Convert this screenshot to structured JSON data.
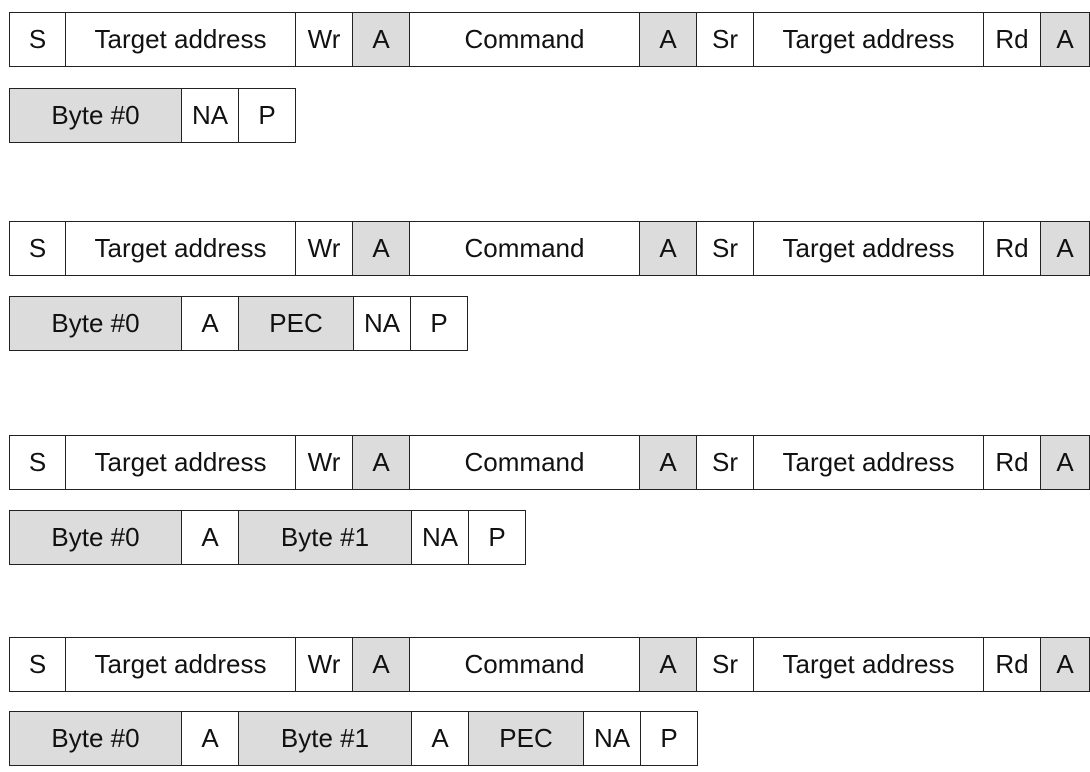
{
  "sequences": [
    {
      "line1": [
        "S",
        "Target address",
        "Wr",
        "A",
        "Command",
        "A",
        "Sr",
        "Target address",
        "Rd",
        "A"
      ],
      "line2": [
        "Byte #0",
        "NA",
        "P"
      ]
    },
    {
      "line1": [
        "S",
        "Target address",
        "Wr",
        "A",
        "Command",
        "A",
        "Sr",
        "Target address",
        "Rd",
        "A"
      ],
      "line2": [
        "Byte #0",
        "A",
        "PEC",
        "NA",
        "P"
      ]
    },
    {
      "line1": [
        "S",
        "Target address",
        "Wr",
        "A",
        "Command",
        "A",
        "Sr",
        "Target address",
        "Rd",
        "A"
      ],
      "line2": [
        "Byte #0",
        "A",
        "Byte #1",
        "NA",
        "P"
      ]
    },
    {
      "line1": [
        "S",
        "Target address",
        "Wr",
        "A",
        "Command",
        "A",
        "Sr",
        "Target address",
        "Rd",
        "A"
      ],
      "line2": [
        "Byte #0",
        "A",
        "Byte #1",
        "A",
        "PEC",
        "NA",
        "P"
      ]
    }
  ],
  "colors": {
    "shaded": "#dcdcdc",
    "plain": "#ffffff",
    "border": "#222222"
  }
}
